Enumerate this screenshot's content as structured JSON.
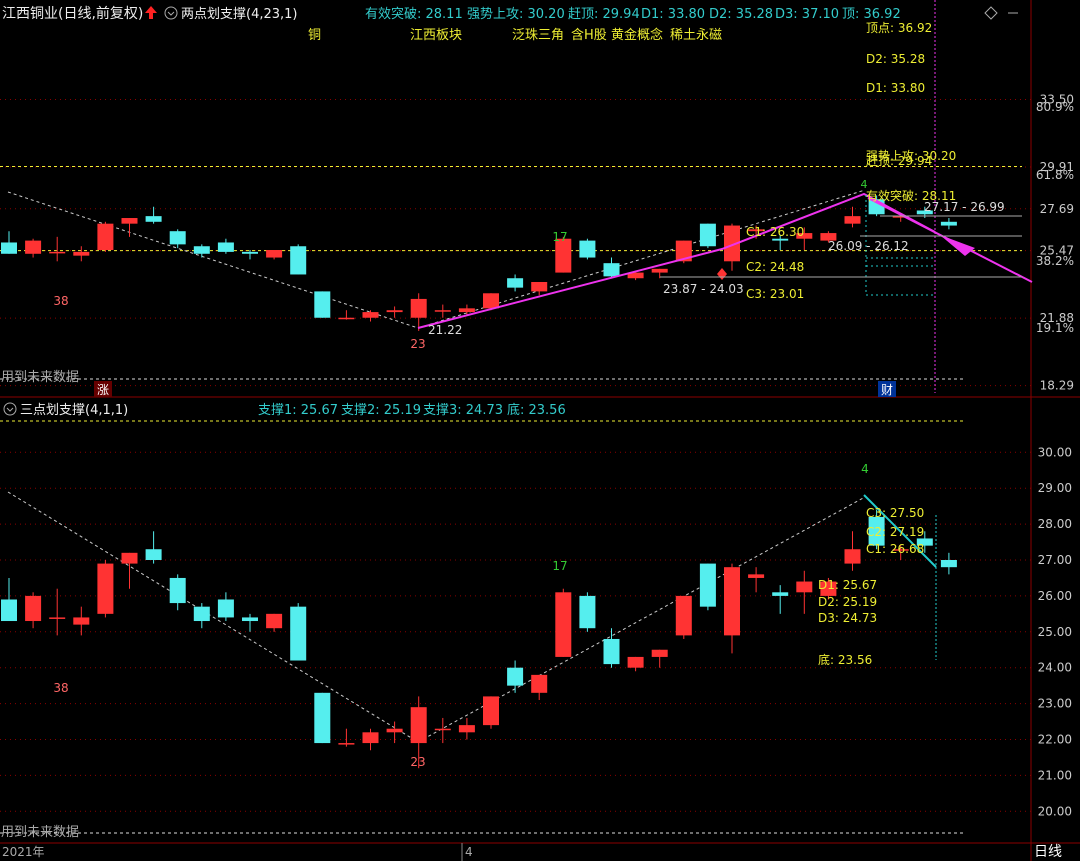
{
  "top_panel": {
    "title": "江西铜业(日线,前复权)",
    "indicator_name": "两点划支撑(4,23,1)",
    "labels": [
      {
        "text": "有效突破: 28.11",
        "color": "#33cccc"
      },
      {
        "text": "强势上攻: 30.20",
        "color": "#33cccc"
      },
      {
        "text": "赶顶: 29.94",
        "color": "#33cccc"
      },
      {
        "text": "D1: 33.80",
        "color": "#33cccc"
      },
      {
        "text": "D2: 35.28",
        "color": "#33cccc"
      },
      {
        "text": "D3: 37.10",
        "color": "#33cccc"
      },
      {
        "text": "顶: 36.92",
        "color": "#33cccc"
      }
    ],
    "tags": [
      "铜",
      "江西板块",
      "泛珠三角",
      "含H股",
      "黄金概念",
      "稀土永磁"
    ],
    "future_note": "用到未来数据",
    "flag_zhang": "涨",
    "flag_cai": "财"
  },
  "bottom_panel": {
    "indicator_name": "三点划支撑(4,1,1)",
    "labels": [
      {
        "text": "支撑1: 25.67",
        "color": "#33cccc"
      },
      {
        "text": "支撑2: 25.19",
        "color": "#33cccc"
      },
      {
        "text": "支撑3: 24.73",
        "color": "#33cccc"
      },
      {
        "text": "底: 23.56",
        "color": "#33cccc"
      }
    ],
    "future_note": "用到未来数据"
  },
  "time_axis": {
    "year_label": "2021年",
    "month_label": "4",
    "period_label": "日线"
  },
  "colors": {
    "up": "#ff3333",
    "down": "#55eeee",
    "magenta": "#ee33ee",
    "cyan": "#22cccc",
    "yellow": "#eeee33",
    "grid": "#8b0000"
  },
  "chart_data": [
    {
      "type": "candlestick",
      "panel": "top",
      "ylim": [
        17.9,
        37.3
      ],
      "y_ticks": [
        "18.29",
        "21.88",
        "25.47",
        "27.69",
        "29.91",
        "33.50"
      ],
      "pct_ticks": [
        "19.1%",
        "38.2%",
        "61.8%",
        "80.9%"
      ],
      "candles": [
        {
          "o": 25.9,
          "h": 26.5,
          "l": 25.3,
          "c": 25.3
        },
        {
          "o": 25.3,
          "h": 26.1,
          "l": 25.1,
          "c": 26.0
        },
        {
          "o": 25.4,
          "h": 26.2,
          "l": 24.9,
          "c": 25.4
        },
        {
          "o": 25.2,
          "h": 25.7,
          "l": 24.9,
          "c": 25.4
        },
        {
          "o": 25.5,
          "h": 27.0,
          "l": 25.4,
          "c": 26.9
        },
        {
          "o": 26.9,
          "h": 27.2,
          "l": 26.2,
          "c": 27.2
        },
        {
          "o": 27.3,
          "h": 27.8,
          "l": 26.9,
          "c": 27.0
        },
        {
          "o": 26.5,
          "h": 26.6,
          "l": 25.6,
          "c": 25.8
        },
        {
          "o": 25.7,
          "h": 25.8,
          "l": 25.1,
          "c": 25.3
        },
        {
          "o": 25.9,
          "h": 26.1,
          "l": 25.3,
          "c": 25.4
        },
        {
          "o": 25.4,
          "h": 25.5,
          "l": 25.0,
          "c": 25.3
        },
        {
          "o": 25.1,
          "h": 25.5,
          "l": 25.0,
          "c": 25.5
        },
        {
          "o": 25.7,
          "h": 25.8,
          "l": 24.2,
          "c": 24.2
        },
        {
          "o": 23.3,
          "h": 23.3,
          "l": 21.9,
          "c": 21.9
        },
        {
          "o": 21.9,
          "h": 22.3,
          "l": 21.8,
          "c": 21.9
        },
        {
          "o": 21.9,
          "h": 22.3,
          "l": 21.7,
          "c": 22.2
        },
        {
          "o": 22.2,
          "h": 22.5,
          "l": 21.9,
          "c": 22.3
        },
        {
          "o": 21.9,
          "h": 23.2,
          "l": 21.2,
          "c": 22.9
        },
        {
          "o": 22.3,
          "h": 22.6,
          "l": 21.9,
          "c": 22.3
        },
        {
          "o": 22.2,
          "h": 22.6,
          "l": 22.0,
          "c": 22.4
        },
        {
          "o": 22.4,
          "h": 23.2,
          "l": 22.3,
          "c": 23.2
        },
        {
          "o": 24.0,
          "h": 24.2,
          "l": 23.3,
          "c": 23.5
        },
        {
          "o": 23.3,
          "h": 23.8,
          "l": 23.1,
          "c": 23.8
        },
        {
          "o": 24.3,
          "h": 26.2,
          "l": 24.3,
          "c": 26.1
        },
        {
          "o": 26.0,
          "h": 26.1,
          "l": 25.0,
          "c": 25.1
        },
        {
          "o": 24.8,
          "h": 25.1,
          "l": 24.0,
          "c": 24.1
        },
        {
          "o": 24.0,
          "h": 24.3,
          "l": 23.9,
          "c": 24.3
        },
        {
          "o": 24.3,
          "h": 24.5,
          "l": 24.0,
          "c": 24.5
        },
        {
          "o": 24.9,
          "h": 26.0,
          "l": 24.8,
          "c": 26.0
        },
        {
          "o": 26.9,
          "h": 26.9,
          "l": 25.6,
          "c": 25.7
        },
        {
          "o": 24.9,
          "h": 26.9,
          "l": 24.4,
          "c": 26.8
        },
        {
          "o": 26.5,
          "h": 26.8,
          "l": 26.1,
          "c": 26.6
        },
        {
          "o": 26.1,
          "h": 26.3,
          "l": 25.5,
          "c": 26.0
        },
        {
          "o": 26.1,
          "h": 26.7,
          "l": 25.5,
          "c": 26.4
        },
        {
          "o": 26.0,
          "h": 26.5,
          "l": 25.9,
          "c": 26.4
        },
        {
          "o": 26.9,
          "h": 27.8,
          "l": 26.7,
          "c": 27.3
        },
        {
          "o": 28.2,
          "h": 28.4,
          "l": 27.3,
          "c": 27.4
        },
        {
          "o": 27.3,
          "h": 27.4,
          "l": 27.0,
          "c": 27.3
        },
        {
          "o": 27.6,
          "h": 27.8,
          "l": 27.2,
          "c": 27.4
        },
        {
          "o": 27.0,
          "h": 27.2,
          "l": 26.6,
          "c": 26.8
        }
      ],
      "annotations": [
        {
          "text": "38",
          "color": "#ff6666"
        },
        {
          "text": "17",
          "color": "#33cc33"
        },
        {
          "text": "23",
          "color": "#ff6666"
        },
        {
          "text": "21.22",
          "color": "#dddddd"
        },
        {
          "text": "4",
          "color": "#33cc33"
        },
        {
          "text": "顶点: 36.92",
          "color": "#eeee33"
        },
        {
          "text": "D2: 35.28",
          "color": "#eeee33"
        },
        {
          "text": "D1: 33.80",
          "color": "#eeee33"
        },
        {
          "text": "强势上攻: 30.20",
          "color": "#eeee33"
        },
        {
          "text": "赶顶: 29.94",
          "color": "#eeee33"
        },
        {
          "text": "有效突破: 28.11",
          "color": "#eeee33"
        },
        {
          "text": "27.17 - 26.99",
          "color": "#dddddd"
        },
        {
          "text": "C1: 26.30",
          "color": "#eeee33"
        },
        {
          "text": "26.09 - 26.12",
          "color": "#dddddd"
        },
        {
          "text": "C2: 24.48",
          "color": "#eeee33"
        },
        {
          "text": "23.87 - 24.03",
          "color": "#dddddd"
        },
        {
          "text": "C3: 23.01",
          "color": "#eeee33"
        }
      ]
    },
    {
      "type": "candlestick",
      "panel": "bottom",
      "ylim": [
        19.2,
        30.9
      ],
      "y_ticks": [
        "20.00",
        "21.00",
        "22.00",
        "23.00",
        "24.00",
        "25.00",
        "26.00",
        "27.00",
        "28.00",
        "29.00",
        "30.00"
      ],
      "annotations": [
        {
          "text": "38",
          "color": "#ff6666"
        },
        {
          "text": "17",
          "color": "#33cc33"
        },
        {
          "text": "23",
          "color": "#ff6666"
        },
        {
          "text": "4",
          "color": "#33cc33"
        },
        {
          "text": "C3: 27.50",
          "color": "#eeee33"
        },
        {
          "text": "C2: 27.19",
          "color": "#eeee33"
        },
        {
          "text": "C1: 26.68",
          "color": "#eeee33"
        },
        {
          "text": "D1: 25.67",
          "color": "#eeee33"
        },
        {
          "text": "D2: 25.19",
          "color": "#eeee33"
        },
        {
          "text": "D3: 24.73",
          "color": "#eeee33"
        },
        {
          "text": "底: 23.56",
          "color": "#eeee33"
        }
      ]
    }
  ]
}
